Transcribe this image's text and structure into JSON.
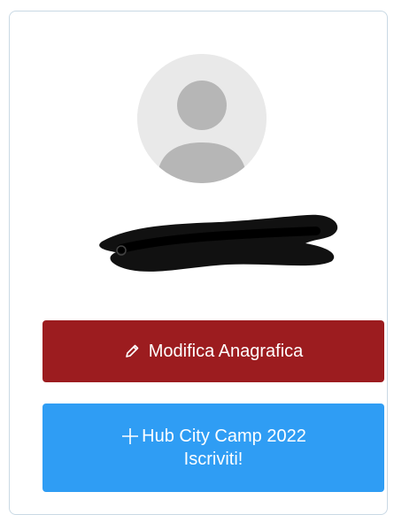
{
  "profile": {
    "avatar_icon": "user-placeholder-icon",
    "name_redacted": true
  },
  "actions": {
    "edit_profile": {
      "icon": "pencil-icon",
      "label": "Modifica Anagrafica",
      "color": "#9c1c1f"
    },
    "camp_signup": {
      "icon": "plus-icon",
      "label_line1": "Hub City Camp 2022",
      "label_line2": "Iscriviti!",
      "color": "#2f9df4"
    }
  }
}
